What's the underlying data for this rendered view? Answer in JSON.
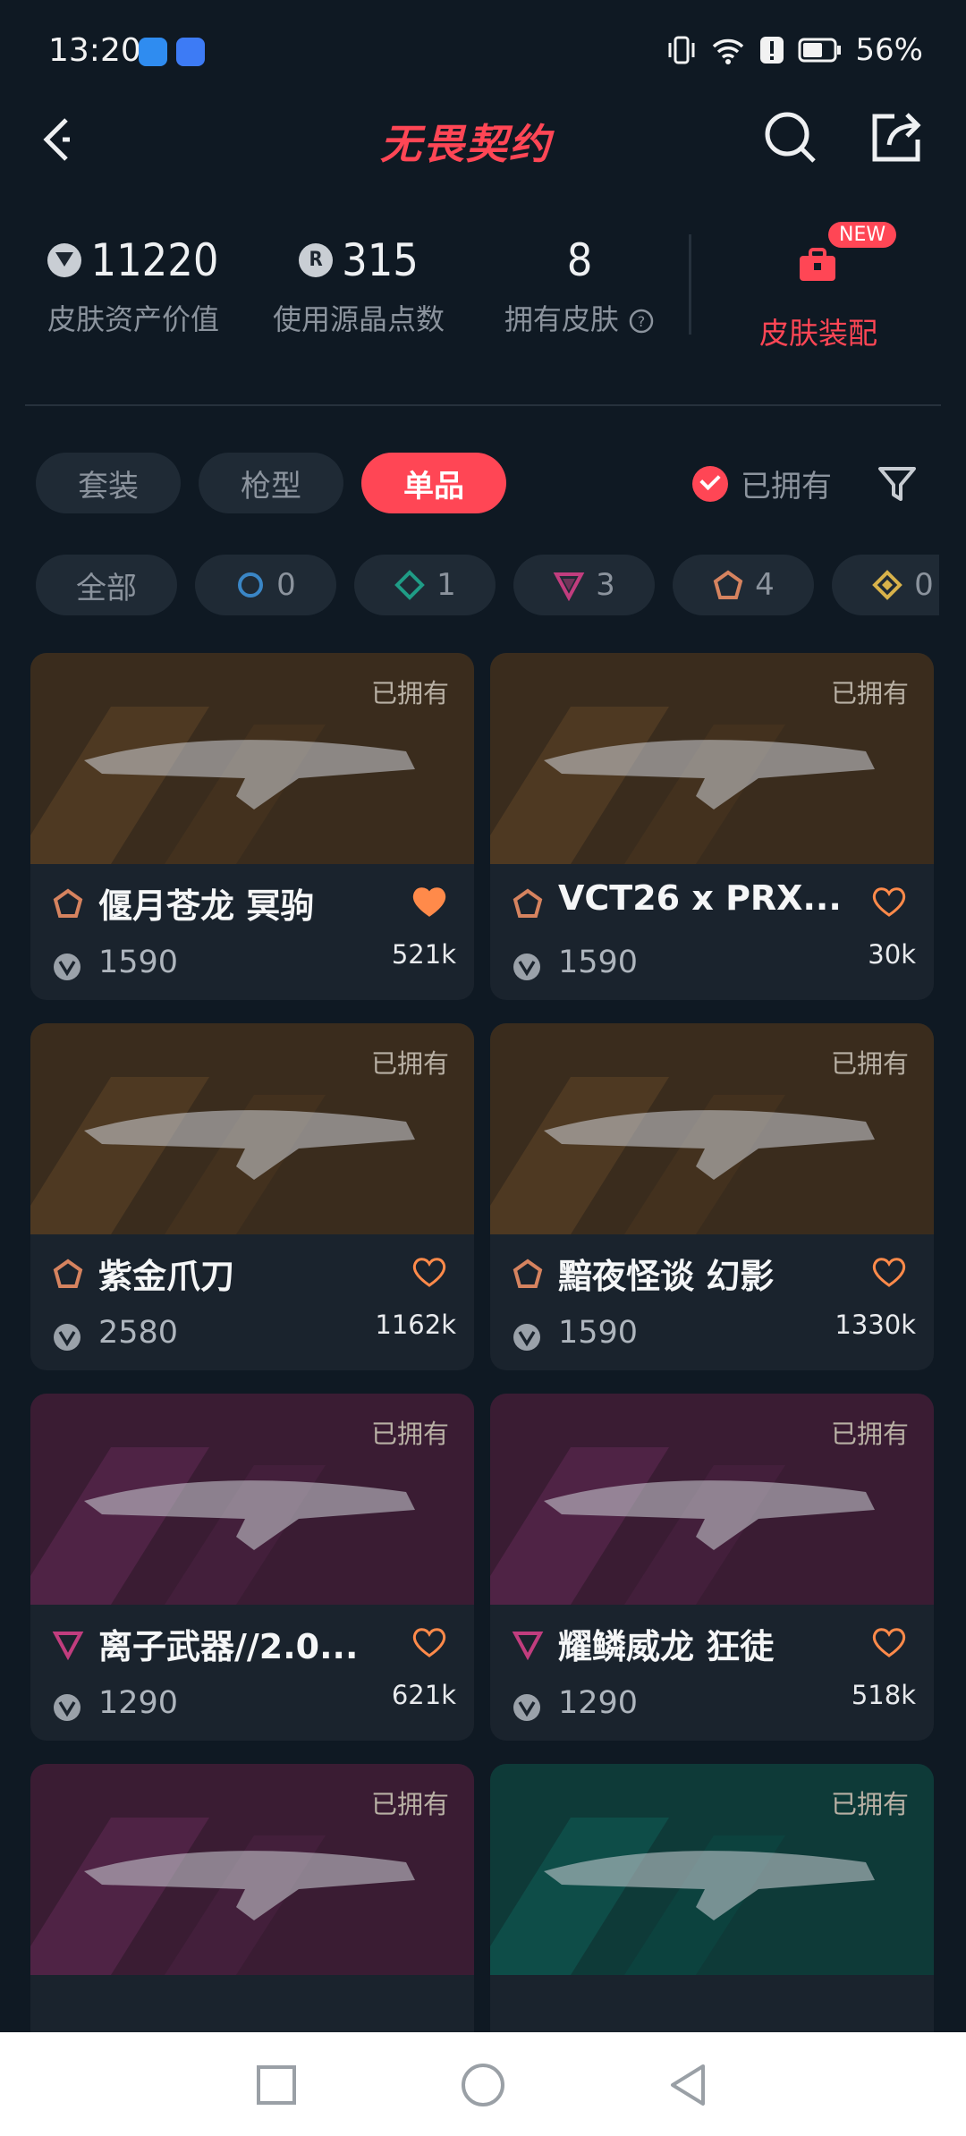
{
  "status": {
    "time": "13:20",
    "battery": "56%"
  },
  "header": {
    "brand": "无畏契约"
  },
  "stats": [
    {
      "value": "11220",
      "label": "皮肤资产价值",
      "icon": "vp-icon"
    },
    {
      "value": "315",
      "label": "使用源晶点数",
      "icon": "radianite-icon"
    },
    {
      "value": "8",
      "label": "拥有皮肤",
      "icon": "help-icon"
    }
  ],
  "equip": {
    "badge": "NEW",
    "label": "皮肤装配"
  },
  "tabs": [
    {
      "label": "套装",
      "active": false
    },
    {
      "label": "枪型",
      "active": false
    },
    {
      "label": "单品",
      "active": true
    }
  ],
  "owned_filter": {
    "label": "已拥有",
    "checked": true
  },
  "rarity_filters": [
    {
      "label": "全部",
      "count": "",
      "color": ""
    },
    {
      "label": "",
      "count": "0",
      "color": "#3a86c6"
    },
    {
      "label": "",
      "count": "1",
      "color": "#1f9c86"
    },
    {
      "label": "",
      "count": "3",
      "color": "#c13d7e"
    },
    {
      "label": "",
      "count": "4",
      "color": "#d6835f"
    },
    {
      "label": "",
      "count": "0",
      "color": "#d8b24a"
    }
  ],
  "cards": [
    {
      "owned": "已拥有",
      "name": "偃月苍龙 冥驹",
      "price": "1590",
      "likes": "521k",
      "liked": true,
      "tier_color": "#d6835f",
      "bg": "brown"
    },
    {
      "owned": "已拥有",
      "name": "VCT26 x PRX...",
      "price": "1590",
      "likes": "30k",
      "liked": false,
      "tier_color": "#d6835f",
      "bg": "brown"
    },
    {
      "owned": "已拥有",
      "name": "紫金爪刀",
      "price": "2580",
      "likes": "1162k",
      "liked": false,
      "tier_color": "#d6835f",
      "bg": "brown"
    },
    {
      "owned": "已拥有",
      "name": "黯夜怪谈 幻影",
      "price": "1590",
      "likes": "1330k",
      "liked": false,
      "tier_color": "#d6835f",
      "bg": "brown"
    },
    {
      "owned": "已拥有",
      "name": "离子武器//2.0...",
      "price": "1290",
      "likes": "621k",
      "liked": false,
      "tier_color": "#c13d7e",
      "bg": "purple"
    },
    {
      "owned": "已拥有",
      "name": "耀鳞威龙 狂徒",
      "price": "1290",
      "likes": "518k",
      "liked": false,
      "tier_color": "#c13d7e",
      "bg": "purple"
    },
    {
      "owned": "已拥有",
      "name": "",
      "price": "",
      "likes": "",
      "liked": false,
      "tier_color": "#c13d7e",
      "bg": "purple"
    },
    {
      "owned": "已拥有",
      "name": "",
      "price": "",
      "likes": "",
      "liked": false,
      "tier_color": "#1f9c86",
      "bg": "teal"
    }
  ]
}
